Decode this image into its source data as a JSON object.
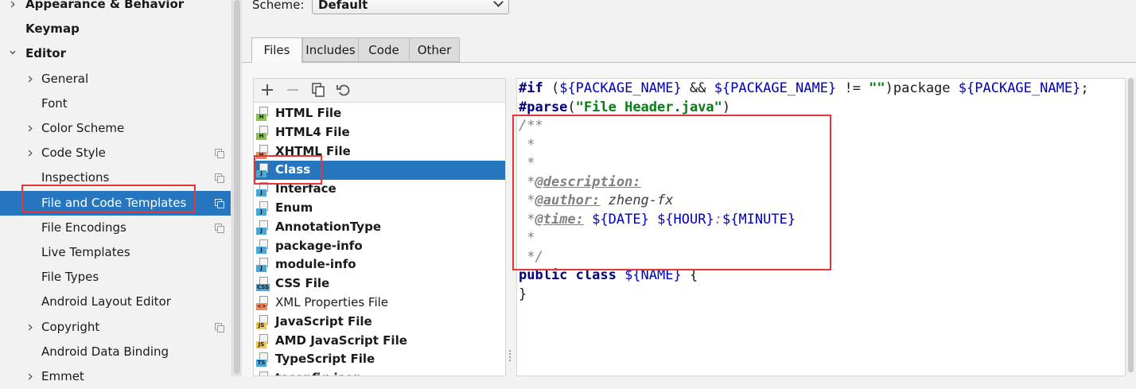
{
  "sidebar": {
    "items": [
      {
        "label": "Appearance & Behavior",
        "bold": true,
        "arrow": "collapsed",
        "indent": 0,
        "copy": false
      },
      {
        "label": "Keymap",
        "bold": true,
        "arrow": "none",
        "indent": 0,
        "copy": false
      },
      {
        "label": "Editor",
        "bold": true,
        "arrow": "expanded",
        "indent": 0,
        "copy": false
      },
      {
        "label": "General",
        "bold": false,
        "arrow": "collapsed",
        "indent": 1,
        "copy": false
      },
      {
        "label": "Font",
        "bold": false,
        "arrow": "none",
        "indent": 1,
        "copy": false
      },
      {
        "label": "Color Scheme",
        "bold": false,
        "arrow": "collapsed",
        "indent": 1,
        "copy": false
      },
      {
        "label": "Code Style",
        "bold": false,
        "arrow": "collapsed",
        "indent": 1,
        "copy": true
      },
      {
        "label": "Inspections",
        "bold": false,
        "arrow": "none",
        "indent": 1,
        "copy": true
      },
      {
        "label": "File and Code Templates",
        "bold": false,
        "arrow": "none",
        "indent": 1,
        "copy": true,
        "selected": true
      },
      {
        "label": "File Encodings",
        "bold": false,
        "arrow": "none",
        "indent": 1,
        "copy": true
      },
      {
        "label": "Live Templates",
        "bold": false,
        "arrow": "none",
        "indent": 1,
        "copy": false
      },
      {
        "label": "File Types",
        "bold": false,
        "arrow": "none",
        "indent": 1,
        "copy": false
      },
      {
        "label": "Android Layout Editor",
        "bold": false,
        "arrow": "none",
        "indent": 1,
        "copy": false
      },
      {
        "label": "Copyright",
        "bold": false,
        "arrow": "collapsed",
        "indent": 1,
        "copy": true
      },
      {
        "label": "Android Data Binding",
        "bold": false,
        "arrow": "none",
        "indent": 1,
        "copy": false
      },
      {
        "label": "Emmet",
        "bold": false,
        "arrow": "collapsed",
        "indent": 1,
        "copy": false
      }
    ]
  },
  "scheme": {
    "label": "Scheme:",
    "value": "Default"
  },
  "tabs": [
    {
      "label": "Files",
      "active": true
    },
    {
      "label": "Includes",
      "active": false
    },
    {
      "label": "Code",
      "active": false
    },
    {
      "label": "Other",
      "active": false
    }
  ],
  "toolbar": {
    "add_icon": "plus-icon",
    "remove_icon": "minus-icon",
    "copy_icon": "copy-icon",
    "reset_icon": "undo-icon"
  },
  "templates": [
    {
      "name": "HTML File",
      "badge": "H",
      "badge_color": "#8bc34a",
      "bold": true
    },
    {
      "name": "HTML4 File",
      "badge": "H",
      "badge_color": "#8bc34a",
      "bold": true
    },
    {
      "name": "XHTML File",
      "badge": "H",
      "badge_color": "#f08a5d",
      "bold": true
    },
    {
      "name": "Class",
      "badge": "J",
      "badge_color": "#4aa8d8",
      "bold": true,
      "selected": true
    },
    {
      "name": "Interface",
      "badge": "J",
      "badge_color": "#4aa8d8",
      "bold": true
    },
    {
      "name": "Enum",
      "badge": "J",
      "badge_color": "#4aa8d8",
      "bold": true
    },
    {
      "name": "AnnotationType",
      "badge": "J",
      "badge_color": "#4aa8d8",
      "bold": true
    },
    {
      "name": "package-info",
      "badge": "J",
      "badge_color": "#4aa8d8",
      "bold": true
    },
    {
      "name": "module-info",
      "badge": "J",
      "badge_color": "#4aa8d8",
      "bold": true
    },
    {
      "name": "CSS File",
      "badge": "CSS",
      "badge_color": "#4aa8d8",
      "bold": true
    },
    {
      "name": "XML Properties File",
      "badge": "<>",
      "badge_color": "#f08a5d",
      "bold": false
    },
    {
      "name": "JavaScript File",
      "badge": "JS",
      "badge_color": "#f2c94c",
      "bold": true
    },
    {
      "name": "AMD JavaScript File",
      "badge": "JS",
      "badge_color": "#f2c94c",
      "bold": true
    },
    {
      "name": "TypeScript File",
      "badge": "TS",
      "badge_color": "#4aa8d8",
      "bold": true
    },
    {
      "name": "tsconfig.json",
      "badge": "{}",
      "badge_color": "#9a9a9a",
      "bold": true
    }
  ],
  "code": {
    "line1": [
      {
        "t": "#if",
        "c": "kw"
      },
      {
        "t": " (",
        "c": ""
      },
      {
        "t": "${PACKAGE_NAME}",
        "c": "var"
      },
      {
        "t": " && ",
        "c": ""
      },
      {
        "t": "${PACKAGE_NAME}",
        "c": "var"
      },
      {
        "t": " != ",
        "c": ""
      },
      {
        "t": "\"\"",
        "c": "str"
      },
      {
        "t": ")package ",
        "c": ""
      },
      {
        "t": "${PACKAGE_NAME}",
        "c": "var"
      },
      {
        "t": ";",
        "c": ""
      }
    ],
    "line2": [
      {
        "t": "#parse",
        "c": "kw"
      },
      {
        "t": "(",
        "c": ""
      },
      {
        "t": "\"File Header.java\"",
        "c": "str"
      },
      {
        "t": ")",
        "c": ""
      }
    ],
    "line3": [
      {
        "t": "/**",
        "c": "cm"
      }
    ],
    "line4": [
      {
        "t": " *",
        "c": "cm"
      }
    ],
    "line5": [
      {
        "t": " *",
        "c": "cm"
      }
    ],
    "line6": [
      {
        "t": " *",
        "c": "cm"
      },
      {
        "t": "@description:",
        "c": "tag"
      }
    ],
    "line7": [
      {
        "t": " *",
        "c": "cm"
      },
      {
        "t": "@author:",
        "c": "tag"
      },
      {
        "t": " zheng-fx",
        "c": "tagv"
      }
    ],
    "line8": [
      {
        "t": " *",
        "c": "cm"
      },
      {
        "t": "@time:",
        "c": "tag"
      },
      {
        "t": " ",
        "c": ""
      },
      {
        "t": "${DATE}",
        "c": "var"
      },
      {
        "t": " ",
        "c": ""
      },
      {
        "t": "${HOUR}",
        "c": "var"
      },
      {
        "t": ":",
        "c": "cm"
      },
      {
        "t": "${MINUTE}",
        "c": "var"
      }
    ],
    "line9": [
      {
        "t": " *",
        "c": "cm"
      }
    ],
    "line10": [
      {
        "t": " */",
        "c": "cm"
      }
    ],
    "line11": [
      {
        "t": "public class ",
        "c": "kw"
      },
      {
        "t": "${NAME}",
        "c": "var"
      },
      {
        "t": " {",
        "c": ""
      }
    ],
    "line12": [
      {
        "t": "}",
        "c": ""
      }
    ]
  }
}
